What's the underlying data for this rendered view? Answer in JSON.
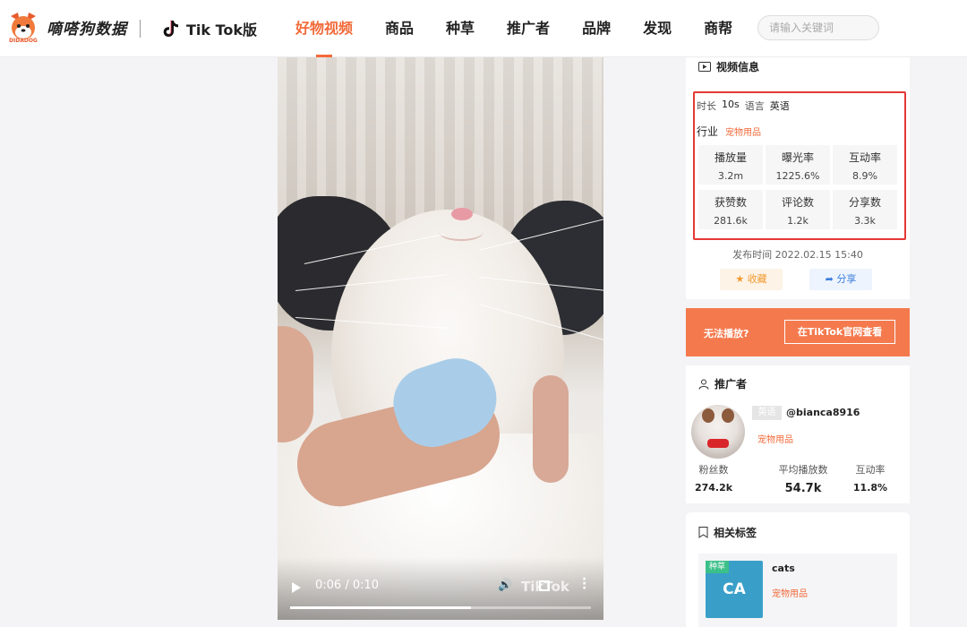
{
  "header": {
    "logo_name": "嘀嗒狗数据",
    "logo_sub": "DIDADOG",
    "platform_label": "Tik Tok版",
    "nav": [
      {
        "label": "好物视频",
        "active": true
      },
      {
        "label": "商品",
        "active": false
      },
      {
        "label": "种草",
        "active": false
      },
      {
        "label": "推广者",
        "active": false
      },
      {
        "label": "品牌",
        "active": false
      },
      {
        "label": "发现",
        "active": false
      },
      {
        "label": "商帮",
        "active": false
      }
    ],
    "search_placeholder": "请输入关键词"
  },
  "video": {
    "time": "0:06 / 0:10",
    "watermark": "TikTok",
    "progress_fraction": 0.6
  },
  "video_info": {
    "title": "视频信息",
    "duration_label": "时长",
    "duration_value": "10s",
    "language_label": "语言",
    "language_value": "英语",
    "industry_label": "行业",
    "industry_value": "宠物用品",
    "stats": [
      {
        "label": "播放量",
        "value": "3.2m"
      },
      {
        "label": "曝光率",
        "value": "1225.6%"
      },
      {
        "label": "互动率",
        "value": "8.9%"
      },
      {
        "label": "获赞数",
        "value": "281.6k"
      },
      {
        "label": "评论数",
        "value": "1.2k"
      },
      {
        "label": "分享数",
        "value": "3.3k"
      }
    ],
    "publish_time": "发布时间 2022.02.15 15:40",
    "favorite_label": "收藏",
    "share_label": "分享"
  },
  "banner": {
    "text": "无法播放?",
    "button_label": "在TikTok官网查看"
  },
  "promoter": {
    "title": "推广者",
    "language_badge": "英语",
    "handle": "@bianca8916",
    "category": "宠物用品",
    "stats": [
      {
        "label": "粉丝数",
        "value": "274.2k"
      },
      {
        "label": "平均播放数",
        "value": "54.7k"
      },
      {
        "label": "互动率",
        "value": "11.8%"
      }
    ]
  },
  "tags": {
    "title": "相关标签",
    "items": [
      {
        "badge": "种草",
        "thumb_text": "CA",
        "name": "cats",
        "category": "宠物用品"
      }
    ]
  },
  "colors": {
    "accent": "#f26a3a",
    "highlight_box": "#e53935",
    "banner": "#f47a4e"
  }
}
